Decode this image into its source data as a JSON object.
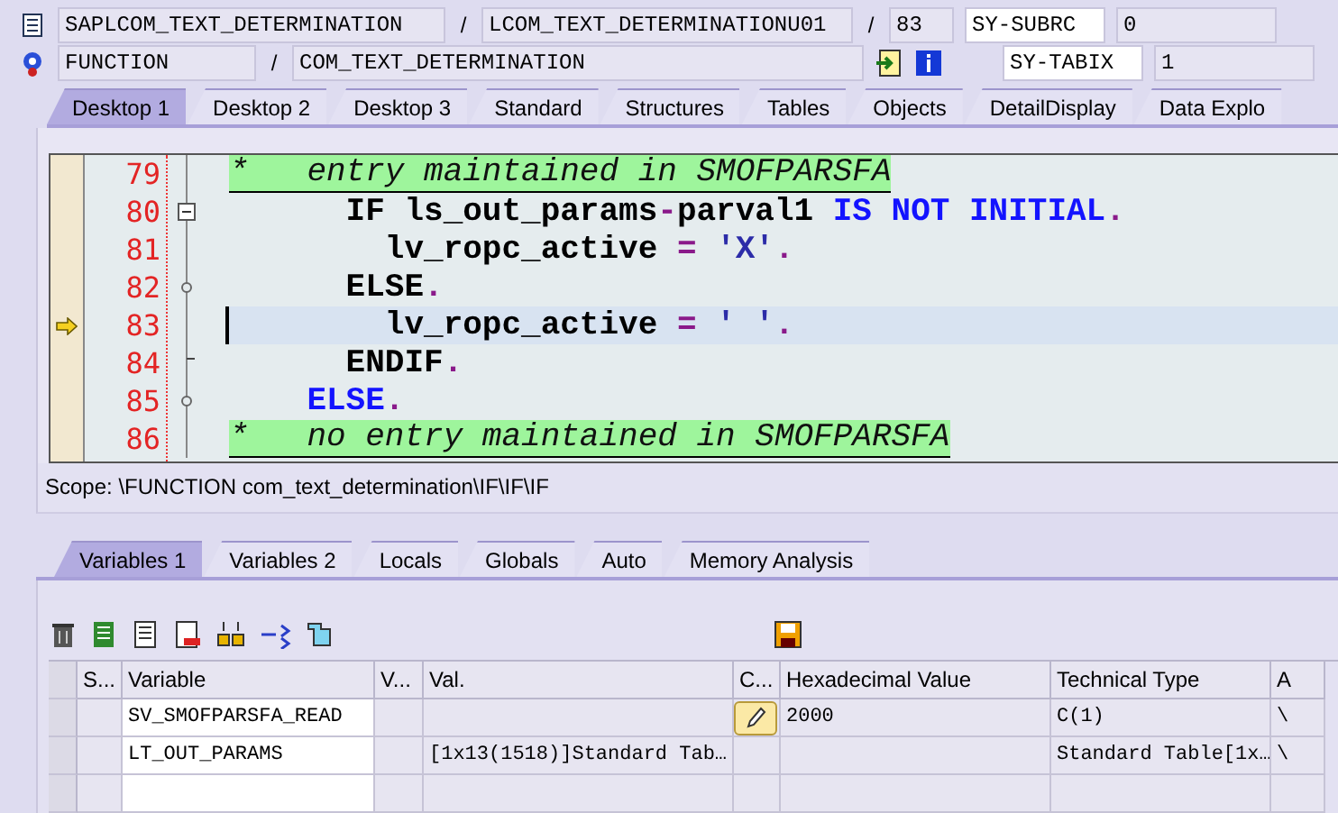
{
  "header": {
    "program": "SAPLCOM_TEXT_DETERMINATION",
    "include": "LCOM_TEXT_DETERMINATIONU01",
    "line": "83",
    "sy_subrc_label": "SY-SUBRC",
    "sy_subrc_value": "0",
    "event_type": "FUNCTION",
    "event_name": "COM_TEXT_DETERMINATION",
    "sy_tabix_label": "SY-TABIX",
    "sy_tabix_value": "1",
    "separators": [
      "/",
      "/",
      "/"
    ]
  },
  "desktop_tabs": [
    {
      "label": "Desktop 1",
      "selected": true
    },
    {
      "label": "Desktop 2",
      "selected": false
    },
    {
      "label": "Desktop 3",
      "selected": false
    },
    {
      "label": "Standard",
      "selected": false
    },
    {
      "label": "Structures",
      "selected": false
    },
    {
      "label": "Tables",
      "selected": false
    },
    {
      "label": "Objects",
      "selected": false
    },
    {
      "label": "DetailDisplay",
      "selected": false
    },
    {
      "label": "Data Explo",
      "selected": false
    }
  ],
  "code_lines": [
    {
      "number": "79",
      "current": false,
      "tokens": [
        {
          "kind": "comment",
          "text": "*   entry maintained in SMOFPARSFA"
        }
      ]
    },
    {
      "number": "80",
      "current": false,
      "tokens": [
        {
          "kind": "code",
          "text": "      IF ls_out_params"
        },
        {
          "kind": "op",
          "text": "-"
        },
        {
          "kind": "code",
          "text": "parval1 "
        },
        {
          "kind": "keyword",
          "text": "IS NOT INITIAL"
        },
        {
          "kind": "op",
          "text": "."
        }
      ]
    },
    {
      "number": "81",
      "current": false,
      "tokens": [
        {
          "kind": "code",
          "text": "        lv_ropc_active "
        },
        {
          "kind": "op",
          "text": "="
        },
        {
          "kind": "string",
          "text": " 'X'"
        },
        {
          "kind": "op",
          "text": "."
        }
      ]
    },
    {
      "number": "82",
      "current": false,
      "tokens": [
        {
          "kind": "code",
          "text": "      ELSE"
        },
        {
          "kind": "op",
          "text": "."
        }
      ]
    },
    {
      "number": "83",
      "current": true,
      "tokens": [
        {
          "kind": "code",
          "text": "        lv_ropc_active "
        },
        {
          "kind": "op",
          "text": "="
        },
        {
          "kind": "string",
          "text": " ' '"
        },
        {
          "kind": "op",
          "text": "."
        }
      ]
    },
    {
      "number": "84",
      "current": false,
      "tokens": [
        {
          "kind": "code",
          "text": "      ENDIF"
        },
        {
          "kind": "op",
          "text": "."
        }
      ]
    },
    {
      "number": "85",
      "current": false,
      "tokens": [
        {
          "kind": "keyword",
          "text": "    ELSE"
        },
        {
          "kind": "op",
          "text": "."
        }
      ]
    },
    {
      "number": "86",
      "current": false,
      "tokens": [
        {
          "kind": "comment",
          "text": "*   no entry maintained in SMOFPARSFA"
        }
      ]
    }
  ],
  "scope": "Scope: \\FUNCTION com_text_determination\\IF\\IF\\IF",
  "variable_tabs": [
    {
      "label": "Variables 1",
      "selected": true
    },
    {
      "label": "Variables 2",
      "selected": false
    },
    {
      "label": "Locals",
      "selected": false
    },
    {
      "label": "Globals",
      "selected": false
    },
    {
      "label": "Auto",
      "selected": false
    },
    {
      "label": "Memory Analysis",
      "selected": false
    }
  ],
  "table": {
    "columns": [
      "S...",
      "Variable",
      "V...",
      "Val.",
      "C...",
      "Hexadecimal Value",
      "Technical Type",
      "A"
    ],
    "rows": [
      {
        "cells": [
          "",
          "SV_SMOFPARSFA_READ",
          "",
          "",
          "",
          "2000",
          "C(1)",
          "\\"
        ],
        "change_button": true
      },
      {
        "cells": [
          "",
          "LT_OUT_PARAMS",
          "",
          "[1x13(1518)]Standard Tab…",
          "",
          "",
          "Standard Table[1x…",
          "\\"
        ],
        "change_button": false
      },
      {
        "cells": [
          "",
          "",
          "",
          "",
          "",
          "",
          "",
          ""
        ],
        "change_button": false
      }
    ]
  }
}
